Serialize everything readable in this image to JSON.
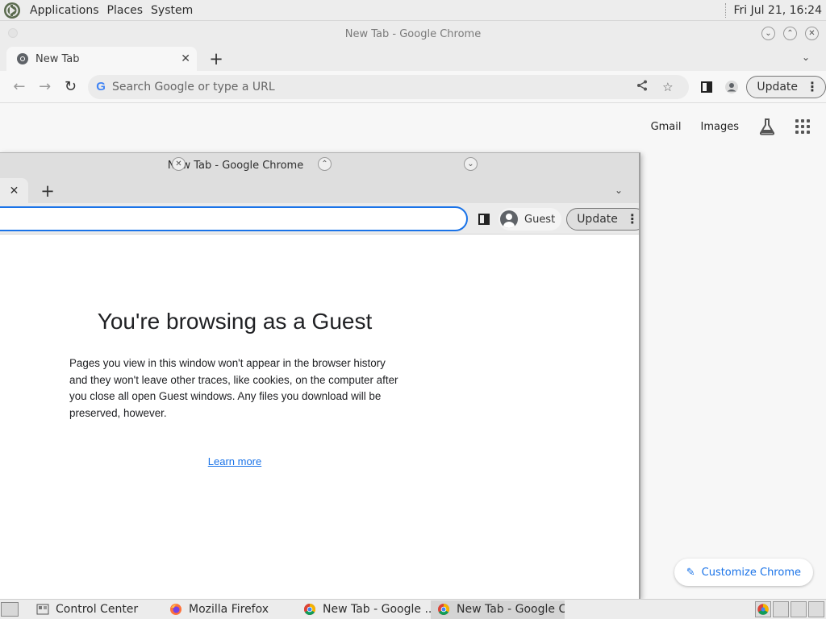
{
  "system_panel": {
    "menus": [
      "Applications",
      "Places",
      "System"
    ],
    "clock": "Fri Jul 21, 16:24"
  },
  "background_window": {
    "title": "New Tab - Google Chrome",
    "tab_title": "New Tab",
    "omnibox_placeholder": "Search Google or type a URL",
    "update_label": "Update",
    "ntp_links": {
      "gmail": "Gmail",
      "images": "Images"
    },
    "customize_label": "Customize Chrome"
  },
  "guest_window": {
    "title": "New Tab - Google Chrome",
    "profile_label": "Guest",
    "update_label": "Update",
    "heading": "You're browsing as a Guest",
    "body": "Pages you view in this window won't appear in the browser history and they won't leave other traces, like cookies, on the computer after you close all open Guest windows. Any files you download will be preserved, however.",
    "learn_more": "Learn more"
  },
  "taskbar": {
    "items": [
      {
        "label": "Control Center",
        "icon": "control-center-icon"
      },
      {
        "label": "Mozilla Firefox",
        "icon": "firefox-icon"
      },
      {
        "label": "New Tab - Google ...",
        "icon": "chrome-icon"
      },
      {
        "label": "New Tab - Google C...",
        "icon": "chrome-icon"
      }
    ]
  },
  "colors": {
    "accent_blue": "#1a73e8",
    "panel_bg": "#ededed",
    "chrome_frame": "#dedede"
  }
}
